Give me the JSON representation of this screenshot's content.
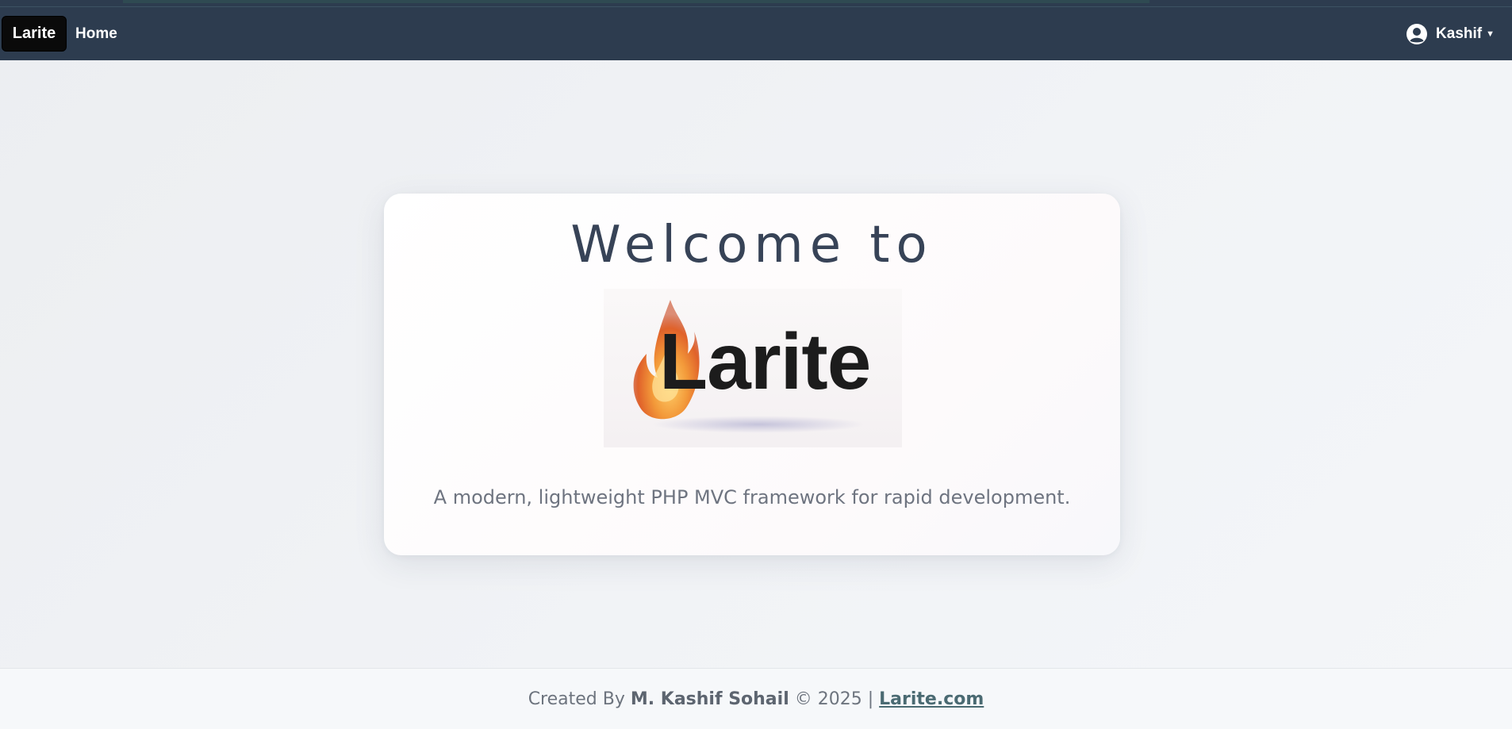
{
  "navbar": {
    "brand": "Larite",
    "links": [
      {
        "label": "Home"
      }
    ],
    "user": {
      "name": "Kashif",
      "icon": "user-circle-icon"
    }
  },
  "hero": {
    "title": "Welcome to",
    "logo_text": "Larite",
    "tagline": "A modern, lightweight PHP MVC framework for rapid development."
  },
  "footer": {
    "prefix": "Created By",
    "author": "M. Kashif Sohail",
    "copyright": "© 2025",
    "separator": "|",
    "link_label": "Larite.com"
  },
  "colors": {
    "navbar_bg": "#2d3c4f",
    "brand_bg": "#0a0a0a",
    "title_color": "#374357",
    "tagline_color": "#6e7480",
    "footer_link": "#4a6a72",
    "flame": "#f08a2c"
  }
}
